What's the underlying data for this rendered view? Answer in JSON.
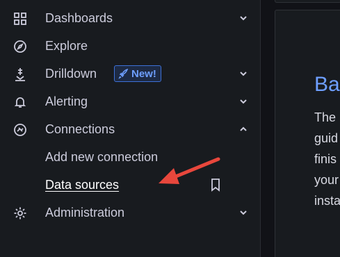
{
  "sidebar": {
    "items": [
      {
        "label": "Dashboards",
        "icon": "apps-grid-icon",
        "chevron": "down"
      },
      {
        "label": "Explore",
        "icon": "compass-icon",
        "chevron": null
      },
      {
        "label": "Drilldown",
        "icon": "drill-icon",
        "chevron": "down",
        "badge": "New!"
      },
      {
        "label": "Alerting",
        "icon": "bell-icon",
        "chevron": "down"
      },
      {
        "label": "Connections",
        "icon": "connections-icon",
        "chevron": "up"
      },
      {
        "label": "Administration",
        "icon": "gear-icon",
        "chevron": "down"
      }
    ],
    "connections_children": [
      {
        "label": "Add new connection"
      },
      {
        "label": "Data sources",
        "active": true
      }
    ]
  },
  "panel": {
    "title": "Ba",
    "lines": [
      "The",
      "guid",
      "finis",
      "your",
      "insta"
    ]
  },
  "colors": {
    "sidebar_bg": "#181b1f",
    "text": "#ccccdc",
    "accent_blue": "#6e9fff",
    "annotation_arrow": "#e8473c"
  }
}
